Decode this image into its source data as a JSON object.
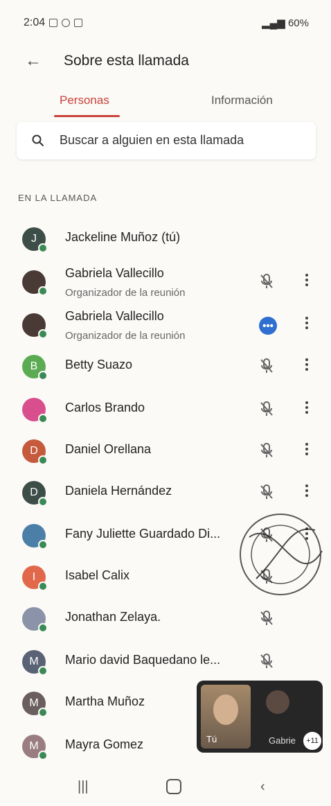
{
  "status_bar": {
    "time": "2:04",
    "battery": "60%"
  },
  "header": {
    "title": "Sobre esta llamada"
  },
  "tabs": [
    {
      "label": "Personas"
    },
    {
      "label": "Información"
    }
  ],
  "search": {
    "placeholder": "Buscar a alguien en esta llamada"
  },
  "section_label": "EN LA LLAMADA",
  "participants": [
    {
      "name": "Jackeline Muñoz (tú)",
      "initial": "J",
      "avatar_color": "#3d4d48"
    },
    {
      "name": "Gabriela Vallecillo",
      "subtitle": "Organizador de la reunión",
      "avatar_color": "#4a3a36"
    },
    {
      "name": "Gabriela Vallecillo",
      "subtitle": "Organizador de la reunión",
      "avatar_color": "#4a3a36"
    },
    {
      "name": "Betty Suazo",
      "initial": "B",
      "avatar_color": "#5bab52"
    },
    {
      "name": "Carlos Brando",
      "avatar_color": "#d94f8e"
    },
    {
      "name": "Daniel Orellana",
      "initial": "D",
      "avatar_color": "#c65a3c"
    },
    {
      "name": "Daniela Hernández",
      "initial": "D",
      "avatar_color": "#3d4d48"
    },
    {
      "name": "Fany Juliette Guardado Di...",
      "avatar_color": "#4c7fa8"
    },
    {
      "name": "Isabel Calix",
      "initial": "I",
      "avatar_color": "#e2684c"
    },
    {
      "name": "Jonathan Zelaya.",
      "avatar_color": "#8a93a8"
    },
    {
      "name": "Mario david Baquedano le...",
      "initial": "M",
      "avatar_color": "#5a6275"
    },
    {
      "name": "Martha Muñoz",
      "initial": "M",
      "avatar_color": "#6b5e5e"
    },
    {
      "name": "Mayra Gomez",
      "initial": "M",
      "avatar_color": "#9a7d80"
    }
  ],
  "speaking_indicator": "•••",
  "pip": {
    "you_label": "Tú",
    "other_label": "Gabrie",
    "more_count": "+11"
  },
  "colors": {
    "accent": "#c9423a",
    "speaking": "#2f6fd1",
    "online": "#3a8a55"
  }
}
